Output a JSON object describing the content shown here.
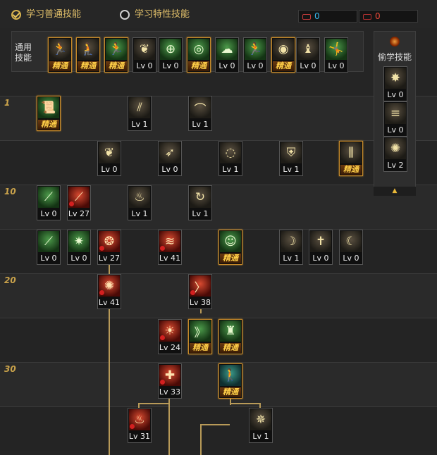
{
  "header": {
    "learn_normal": "学习普通技能",
    "learn_special": "学习特性技能",
    "sp_blue": "0",
    "sp_red": "0"
  },
  "common_skills": {
    "label": "通用\n技能",
    "items": [
      {
        "icon": "crouch-figure-icon",
        "glyph": "🏃",
        "tone": "k",
        "badge": "精通"
      },
      {
        "icon": "kneel-figure-icon",
        "glyph": "🧎",
        "tone": "k",
        "badge": "精通"
      },
      {
        "icon": "leap-figure-icon",
        "glyph": "🏃",
        "tone": "g",
        "badge": "精通"
      },
      {
        "icon": "wings-icon",
        "glyph": "❦",
        "tone": "k",
        "level": "Lv 0"
      },
      {
        "icon": "crosshair-icon",
        "glyph": "⊕",
        "tone": "g",
        "level": "Lv 0"
      },
      {
        "icon": "target-icon",
        "glyph": "◎",
        "tone": "g",
        "badge": "精通"
      },
      {
        "icon": "shout-figure-icon",
        "glyph": "☁",
        "tone": "g",
        "level": "Lv 0"
      },
      {
        "icon": "sprint-figure-icon",
        "glyph": "🏃",
        "tone": "g",
        "level": "Lv 0"
      },
      {
        "icon": "vortex-icon",
        "glyph": "◉",
        "tone": "k",
        "badge": "精通"
      },
      {
        "icon": "strongman-icon",
        "glyph": "♝",
        "tone": "k",
        "level": "Lv 0"
      },
      {
        "icon": "kick-figure-icon",
        "glyph": "🤸",
        "tone": "g",
        "level": "Lv 0"
      }
    ]
  },
  "steal_skills": {
    "title": "偷学技能",
    "items": [
      {
        "icon": "burst-icon",
        "glyph": "✸",
        "tone": "k",
        "level": "Lv 0"
      },
      {
        "icon": "slash-lines-icon",
        "glyph": "≡",
        "tone": "k",
        "level": "Lv 0"
      },
      {
        "icon": "swirl-icon",
        "glyph": "✺",
        "tone": "k",
        "level": "Lv 2"
      }
    ],
    "collapse": "▲"
  },
  "level_labels": [
    "1",
    "10",
    "20",
    "30"
  ],
  "tree": [
    {
      "icon": "skin-scroll-icon",
      "glyph": "📜",
      "tone": "g",
      "badge": "精通"
    },
    {
      "icon": "claw-slash-icon",
      "glyph": "⫽",
      "tone": "k",
      "level": "Lv 1"
    },
    {
      "icon": "arc-slash-icon",
      "glyph": "⌒",
      "tone": "k",
      "level": "Lv 1"
    },
    {
      "icon": "eagle-wings-icon",
      "glyph": "❦",
      "tone": "k",
      "level": "Lv 0"
    },
    {
      "icon": "arrow-strike-icon",
      "glyph": "➶",
      "tone": "k",
      "level": "Lv 0"
    },
    {
      "icon": "spiral-cut-icon",
      "glyph": "◌",
      "tone": "k",
      "level": "Lv 1"
    },
    {
      "icon": "shield-cross-icon",
      "glyph": "⛨",
      "tone": "k",
      "level": "Lv 1"
    },
    {
      "icon": "triple-blade-icon",
      "glyph": "⫼",
      "tone": "k",
      "badge": "精通"
    },
    {
      "icon": "green-blade-icon",
      "glyph": "⟋",
      "tone": "g",
      "level": "Lv 0"
    },
    {
      "icon": "red-blade-icon",
      "glyph": "⟋",
      "tone": "r",
      "level": "Lv 27",
      "dot": true
    },
    {
      "icon": "flame-burst-icon",
      "glyph": "♨",
      "tone": "k",
      "level": "Lv 1"
    },
    {
      "icon": "whirl-slash-icon",
      "glyph": "↻",
      "tone": "k",
      "level": "Lv 1"
    },
    {
      "icon": "green-sword-icon",
      "glyph": "⟋",
      "tone": "g",
      "level": "Lv 0"
    },
    {
      "icon": "green-star-icon",
      "glyph": "✷",
      "tone": "g",
      "level": "Lv 0"
    },
    {
      "icon": "bubbles-icon",
      "glyph": "❂",
      "tone": "r",
      "level": "Lv 27",
      "dot": true
    },
    {
      "icon": "red-claw-icon",
      "glyph": "≋",
      "tone": "r",
      "level": "Lv 41",
      "dot": true
    },
    {
      "icon": "meditate-figure-icon",
      "glyph": "☺",
      "tone": "g",
      "badge": "精通"
    },
    {
      "icon": "crescent-slash-icon",
      "glyph": "☽",
      "tone": "k",
      "level": "Lv 1"
    },
    {
      "icon": "cross-strike-icon",
      "glyph": "✝",
      "tone": "k",
      "level": "Lv 0"
    },
    {
      "icon": "moon-arc-icon",
      "glyph": "☾",
      "tone": "k",
      "level": "Lv 0"
    },
    {
      "icon": "red-whirl-icon",
      "glyph": "✺",
      "tone": "r",
      "level": "Lv 41",
      "dot": true
    },
    {
      "icon": "red-chevron-icon",
      "glyph": "〉",
      "tone": "r",
      "level": "Lv 38",
      "dot": true
    },
    {
      "icon": "red-sun-icon",
      "glyph": "☀",
      "tone": "r",
      "level": "Lv 24",
      "dot": true
    },
    {
      "icon": "green-chevron-icon",
      "glyph": "》",
      "tone": "g",
      "badge": "精通"
    },
    {
      "icon": "muscle-figure-icon",
      "glyph": "♜",
      "tone": "g",
      "badge": "精通"
    },
    {
      "icon": "red-cross-icon",
      "glyph": "✚",
      "tone": "r",
      "level": "Lv 33",
      "dot": true
    },
    {
      "icon": "teal-figure-icon",
      "glyph": "🚶",
      "tone": "t",
      "badge": "精通"
    },
    {
      "icon": "fire-fist-icon",
      "glyph": "♨",
      "tone": "r",
      "level": "Lv 31",
      "dot": true
    },
    {
      "icon": "gold-vortex-icon",
      "glyph": "✵",
      "tone": "k",
      "level": "Lv 1"
    }
  ]
}
